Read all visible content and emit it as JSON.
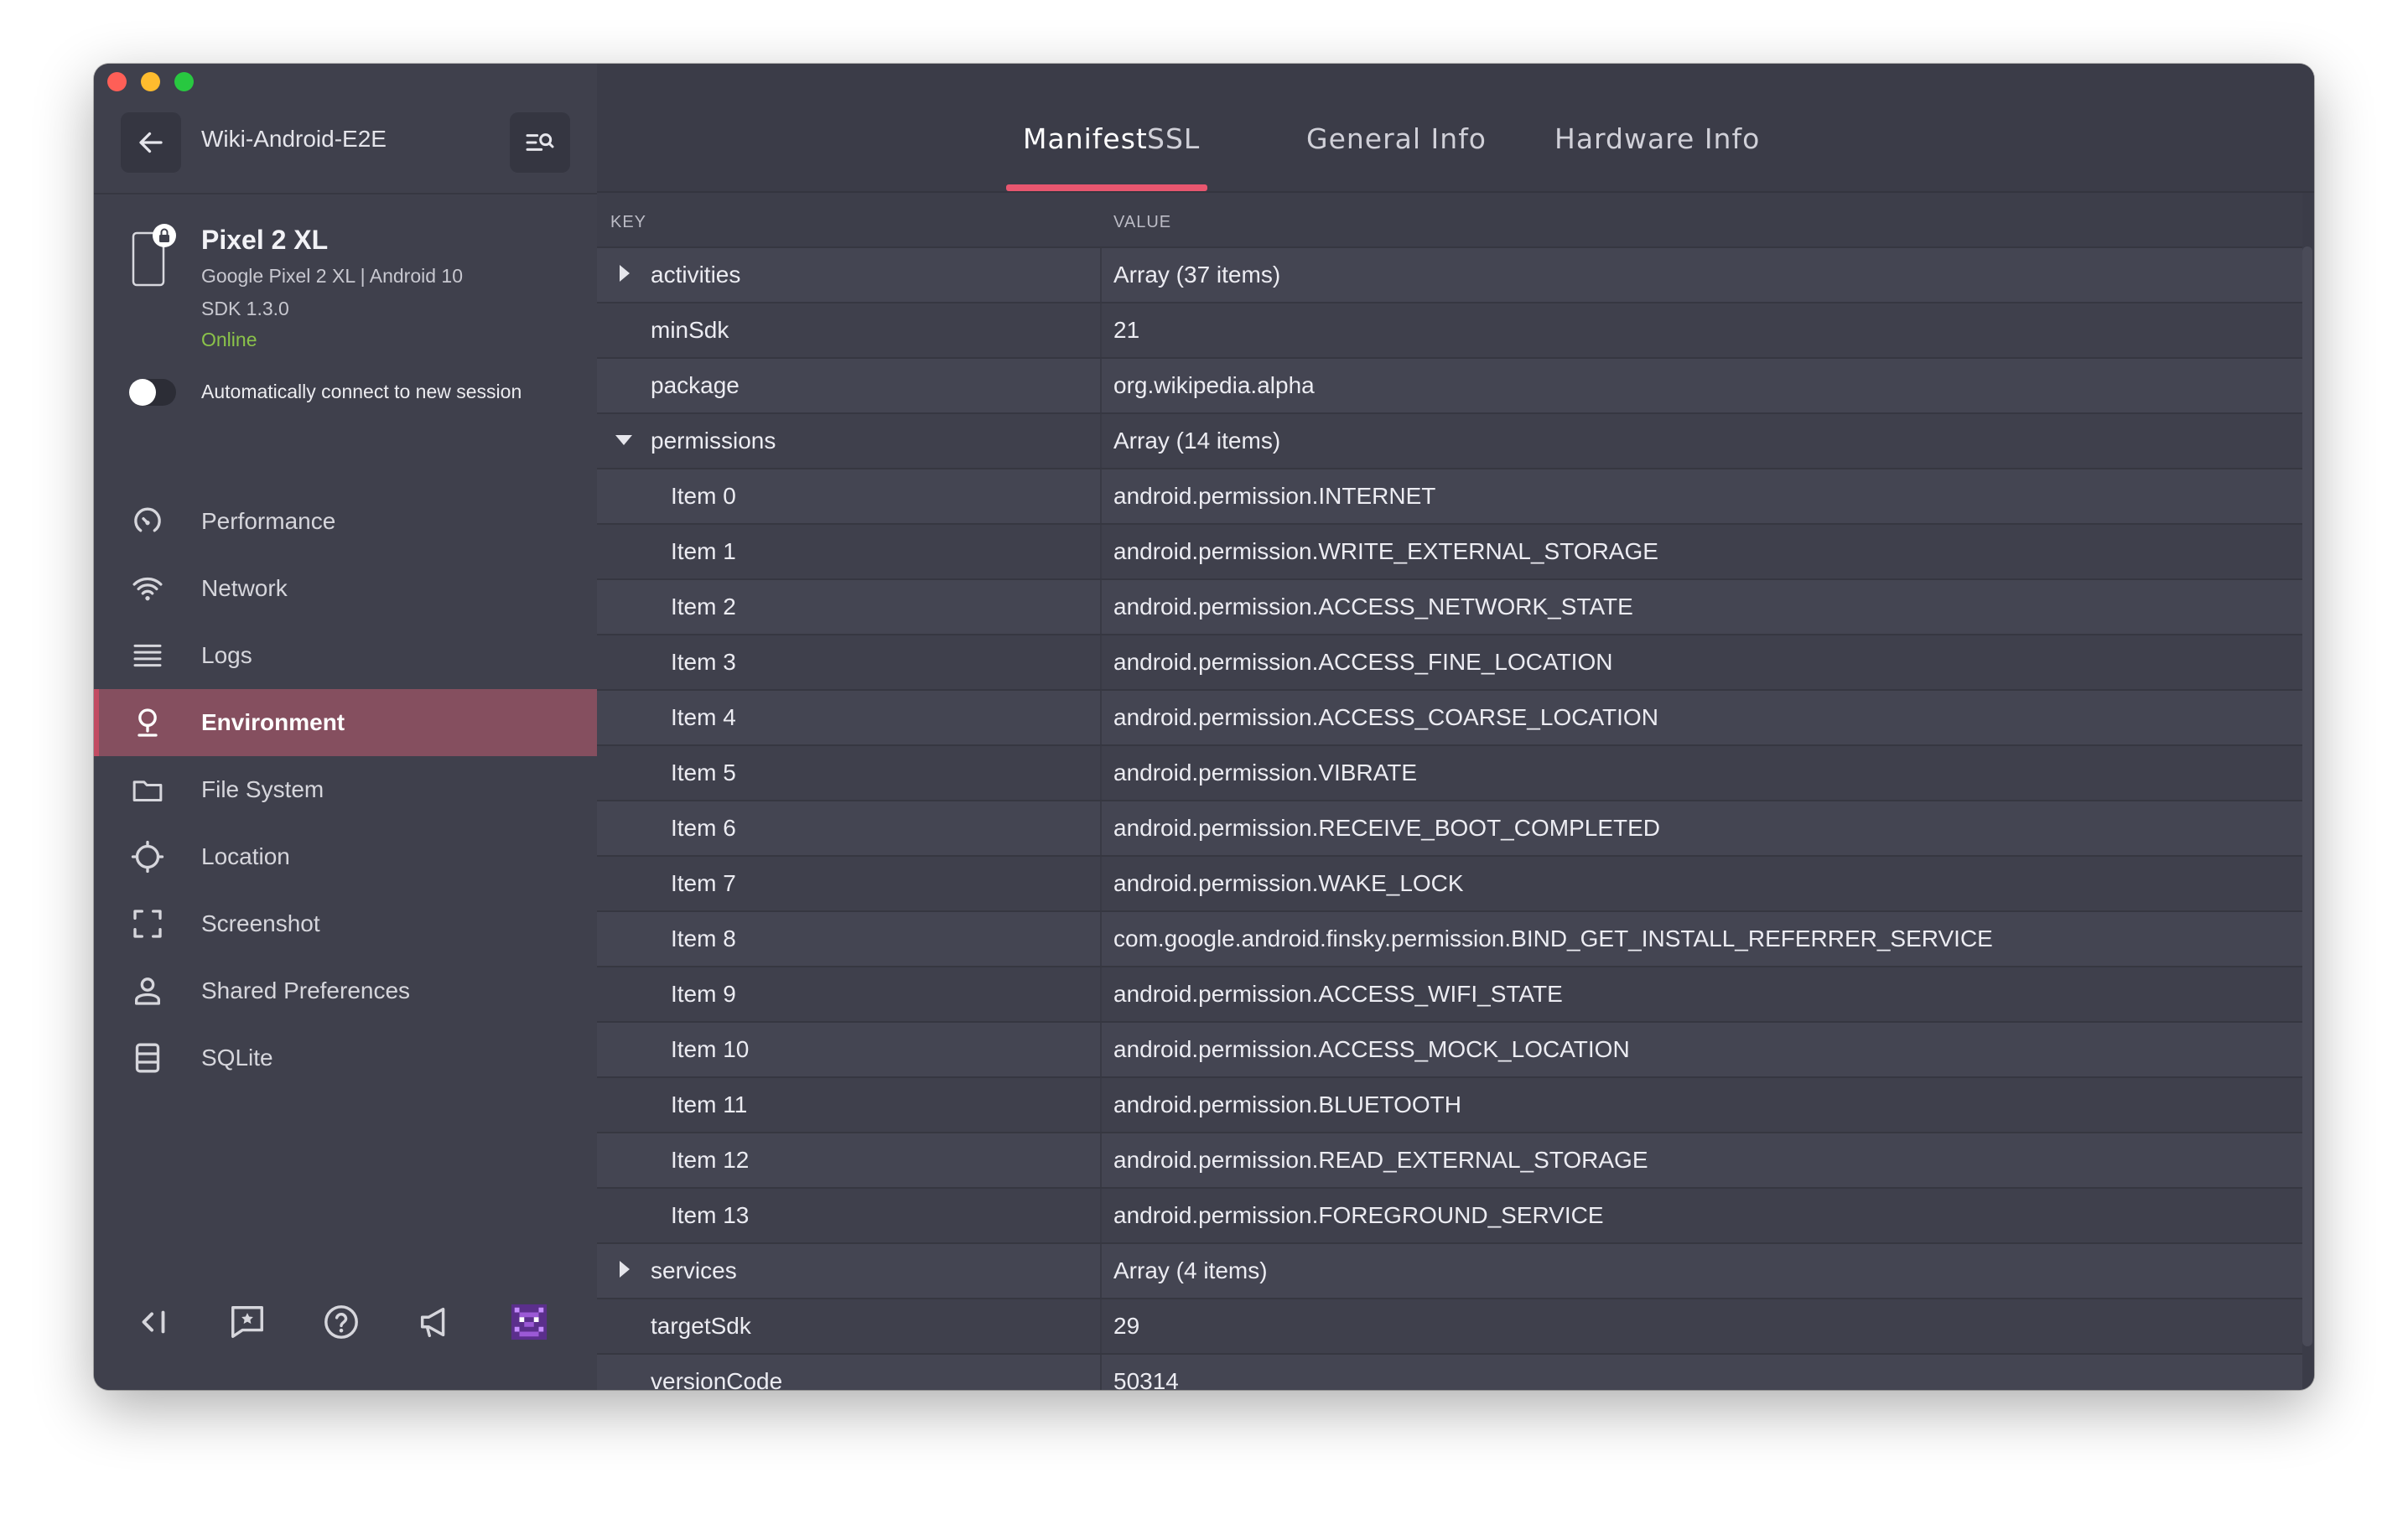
{
  "window": {
    "session_title": "Wiki-Android-E2E",
    "traffic_colors": [
      "#fe5f57",
      "#febc2e",
      "#28c840"
    ]
  },
  "device": {
    "name": "Pixel 2 XL",
    "model_line": "Google Pixel 2 XL | Android 10",
    "sdk_line": "SDK 1.3.0",
    "status": "Online",
    "status_color": "#8bc34a"
  },
  "auto_connect": {
    "label": "Automatically connect to new session",
    "enabled": false
  },
  "sidebar": {
    "items": [
      {
        "label": "Performance",
        "icon": "gauge-icon"
      },
      {
        "label": "Network",
        "icon": "wifi-icon"
      },
      {
        "label": "Logs",
        "icon": "list-icon"
      },
      {
        "label": "Environment",
        "icon": "environment-icon",
        "active": true
      },
      {
        "label": "File System",
        "icon": "folder-icon"
      },
      {
        "label": "Location",
        "icon": "crosshair-icon"
      },
      {
        "label": "Screenshot",
        "icon": "screenshot-icon"
      },
      {
        "label": "Shared Preferences",
        "icon": "person-icon"
      },
      {
        "label": "SQLite",
        "icon": "database-icon"
      }
    ],
    "active_color": "#854f5f"
  },
  "footer_icons": [
    "collapse-icon",
    "feedback-icon",
    "help-icon",
    "announcement-icon",
    "avatar-icon"
  ],
  "tabs": [
    {
      "label": "Manifest",
      "active": true
    },
    {
      "label": "SSL"
    },
    {
      "label": "General Info"
    },
    {
      "label": "Hardware Info"
    }
  ],
  "accent_color": "#e8566f",
  "table": {
    "headers": {
      "key": "KEY",
      "value": "VALUE"
    },
    "rows": [
      {
        "key": "activities",
        "value": "Array (37 items)",
        "caret": "right",
        "level": 0
      },
      {
        "key": "minSdk",
        "value": "21",
        "level": 0
      },
      {
        "key": "package",
        "value": "org.wikipedia.alpha",
        "level": 0
      },
      {
        "key": "permissions",
        "value": "Array (14 items)",
        "caret": "down",
        "level": 0
      },
      {
        "key": "Item 0",
        "value": "android.permission.INTERNET",
        "level": 1
      },
      {
        "key": "Item 1",
        "value": "android.permission.WRITE_EXTERNAL_STORAGE",
        "level": 1
      },
      {
        "key": "Item 2",
        "value": "android.permission.ACCESS_NETWORK_STATE",
        "level": 1
      },
      {
        "key": "Item 3",
        "value": "android.permission.ACCESS_FINE_LOCATION",
        "level": 1
      },
      {
        "key": "Item 4",
        "value": "android.permission.ACCESS_COARSE_LOCATION",
        "level": 1
      },
      {
        "key": "Item 5",
        "value": "android.permission.VIBRATE",
        "level": 1
      },
      {
        "key": "Item 6",
        "value": "android.permission.RECEIVE_BOOT_COMPLETED",
        "level": 1
      },
      {
        "key": "Item 7",
        "value": "android.permission.WAKE_LOCK",
        "level": 1
      },
      {
        "key": "Item 8",
        "value": "com.google.android.finsky.permission.BIND_GET_INSTALL_REFERRER_SERVICE",
        "level": 1
      },
      {
        "key": "Item 9",
        "value": "android.permission.ACCESS_WIFI_STATE",
        "level": 1
      },
      {
        "key": "Item 10",
        "value": "android.permission.ACCESS_MOCK_LOCATION",
        "level": 1
      },
      {
        "key": "Item 11",
        "value": "android.permission.BLUETOOTH",
        "level": 1
      },
      {
        "key": "Item 12",
        "value": "android.permission.READ_EXTERNAL_STORAGE",
        "level": 1
      },
      {
        "key": "Item 13",
        "value": "android.permission.FOREGROUND_SERVICE",
        "level": 1
      },
      {
        "key": "services",
        "value": "Array (4 items)",
        "caret": "right",
        "level": 0
      },
      {
        "key": "targetSdk",
        "value": "29",
        "level": 0
      },
      {
        "key": "versionCode",
        "value": "50314",
        "level": 0
      }
    ]
  }
}
